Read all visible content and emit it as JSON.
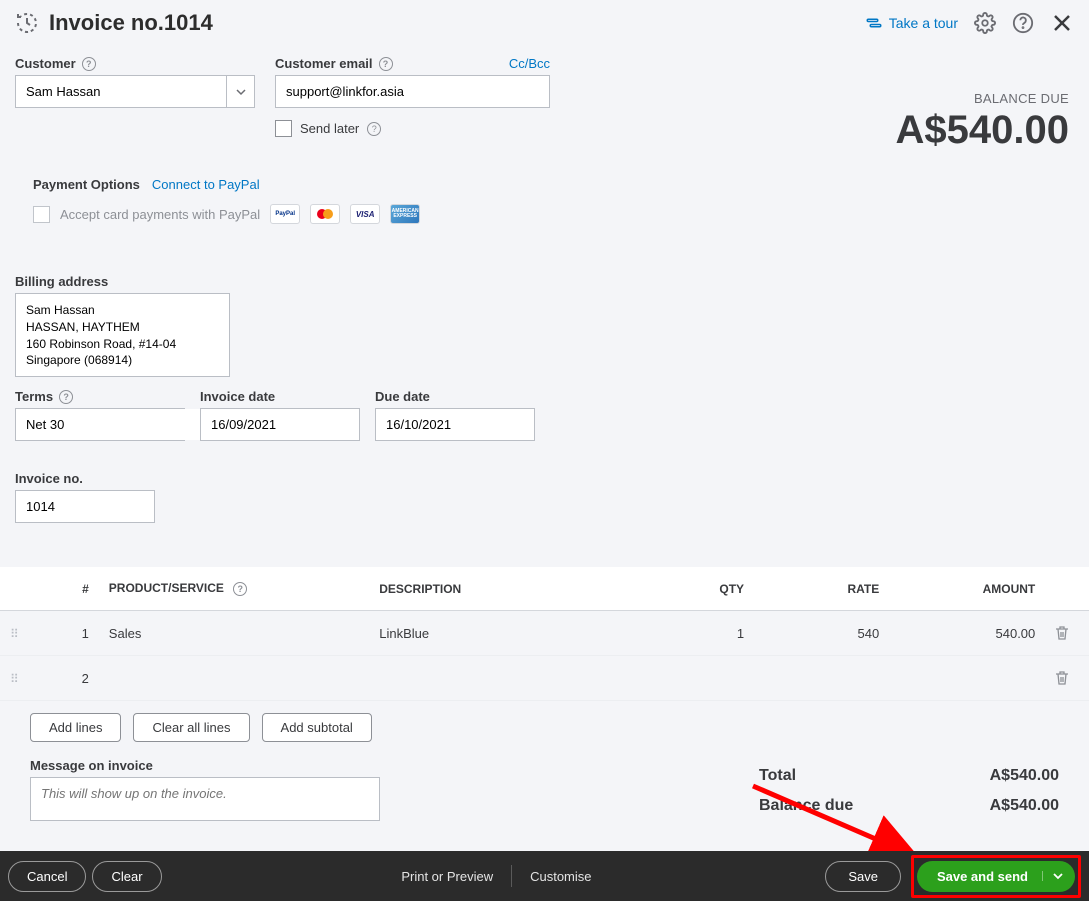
{
  "header": {
    "title": "Invoice no.1014",
    "tour": "Take a tour"
  },
  "customer": {
    "label": "Customer",
    "value": "Sam Hassan",
    "email_label": "Customer email",
    "email_value": "support@linkfor.asia",
    "ccbcc": "Cc/Bcc",
    "send_later": "Send later"
  },
  "payment": {
    "options_label": "Payment Options",
    "connect": "Connect to PayPal",
    "accept": "Accept card payments with PayPal"
  },
  "balance": {
    "label": "BALANCE DUE",
    "amount": "A$540.00"
  },
  "billing": {
    "label": "Billing address",
    "value": "Sam Hassan\nHASSAN, HAYTHEM\n160 Robinson Road, #14-04\nSingapore (068914)"
  },
  "terms": {
    "label": "Terms",
    "value": "Net 30"
  },
  "invoice_date": {
    "label": "Invoice date",
    "value": "16/09/2021"
  },
  "due_date": {
    "label": "Due date",
    "value": "16/10/2021"
  },
  "invoice_no": {
    "label": "Invoice no.",
    "value": "1014"
  },
  "table": {
    "headers": {
      "num": "#",
      "product": "PRODUCT/SERVICE",
      "desc": "DESCRIPTION",
      "qty": "QTY",
      "rate": "RATE",
      "amount": "AMOUNT"
    },
    "rows": [
      {
        "num": "1",
        "product": "Sales",
        "desc": "LinkBlue",
        "qty": "1",
        "rate": "540",
        "amount": "540.00"
      },
      {
        "num": "2",
        "product": "",
        "desc": "",
        "qty": "",
        "rate": "",
        "amount": ""
      }
    ]
  },
  "actions": {
    "add_lines": "Add lines",
    "clear_lines": "Clear all lines",
    "add_subtotal": "Add subtotal"
  },
  "message": {
    "label": "Message on invoice",
    "placeholder": "This will show up on the invoice."
  },
  "totals": {
    "total_label": "Total",
    "total_value": "A$540.00",
    "balance_label": "Balance due",
    "balance_value": "A$540.00"
  },
  "footer": {
    "cancel": "Cancel",
    "clear": "Clear",
    "print": "Print or Preview",
    "customise": "Customise",
    "save": "Save",
    "save_send": "Save and send"
  }
}
